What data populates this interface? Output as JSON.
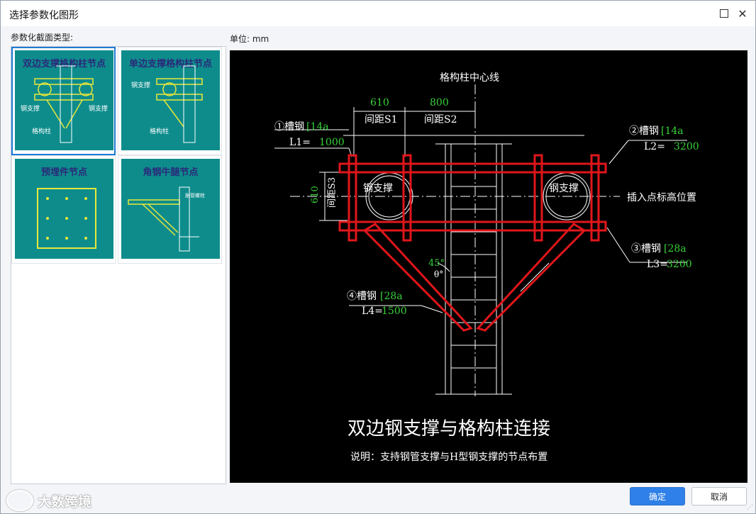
{
  "window": {
    "title": "选择参数化图形"
  },
  "panel": {
    "section_label": "参数化截面类型:",
    "unit_label": "单位:  mm"
  },
  "thumbnails": [
    {
      "caption": "双边支撑格构柱节点",
      "selected": true,
      "labels": [
        "钢支撑",
        "钢支撑",
        "格构柱"
      ]
    },
    {
      "caption": "单边支撑格构柱节点",
      "selected": false,
      "labels": [
        "钢支撑",
        "格构柱"
      ]
    },
    {
      "caption": "预埋件节点",
      "selected": false,
      "labels": []
    },
    {
      "caption": "角钢牛腿节点",
      "selected": false,
      "labels": [
        "胀管螺栓"
      ]
    }
  ],
  "drawing": {
    "centerline_label": "格构柱中心线",
    "dim_s1": "610",
    "dim_s2": "800",
    "label_s1": "间距S1",
    "label_s2": "间距S2",
    "label_s3": "间距S3",
    "dim_s3": "610",
    "pipe_left": "钢支撑",
    "pipe_right": "钢支撑",
    "insert_point": "插入点标高位置",
    "item1": {
      "name": "①槽钢",
      "spec": "[14a",
      "len_label": "L1=",
      "len": "1000"
    },
    "item2": {
      "name": "②槽钢",
      "spec": "[14a",
      "len_label": "L2=",
      "len": "3200"
    },
    "item3": {
      "name": "③槽钢",
      "spec": "[28a",
      "len_label": "L3=",
      "len": "3200"
    },
    "item4": {
      "name": "④槽钢",
      "spec": "[28a",
      "len_label": "L4=",
      "len": "1500"
    },
    "angle": "45°",
    "theta": "θ°",
    "heading": "双边钢支撑与格构柱连接",
    "note": "说明：支持钢管支撑与H型钢支撑的节点布置"
  },
  "buttons": {
    "ok": "确定",
    "cancel": "取消"
  },
  "watermark": {
    "text": "大数跨境"
  },
  "colors": {
    "accent": "#2f80e8",
    "teal": "#0e8c8c",
    "steel_red": "#e0161b",
    "dim_green": "#39d13a"
  }
}
